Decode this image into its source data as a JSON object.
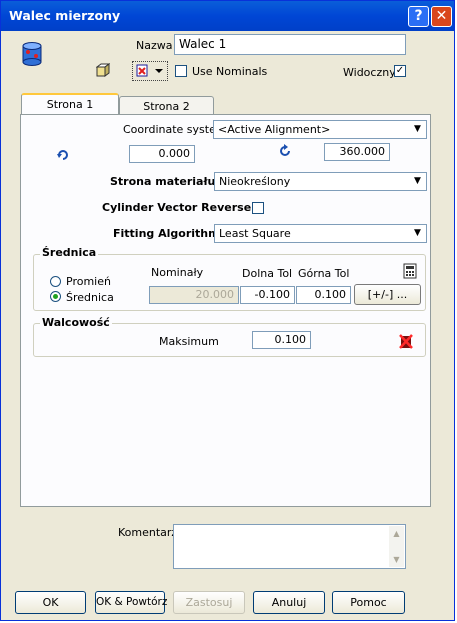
{
  "window": {
    "title": "Walec mierzony",
    "help_glyph": "?",
    "close_glyph": "✕"
  },
  "header": {
    "name_label": "Nazwa",
    "name_value": "Walec 1",
    "use_nominals_label": "Use Nominals",
    "use_nominals_checked": false,
    "visible_label": "Widoczny",
    "visible_checked": true,
    "check_glyph": "✓"
  },
  "tabs": [
    {
      "label": "Strona 1",
      "active": true
    },
    {
      "label": "Strona 2",
      "active": false
    }
  ],
  "page1": {
    "coord_system_label": "Coordinate system",
    "coord_system_value": "<Active Alignment>",
    "angle_start_value": "0.000",
    "angle_end_value": "360.000",
    "material_side_label": "Strona materiału",
    "material_side_value": "Nieokreślony",
    "cyl_vector_reverse_label": "Cylinder Vector Reverse",
    "fitting_algorithm_label": "Fitting Algorithm",
    "fitting_algorithm_value": "Least Square"
  },
  "diameter_group": {
    "title": "Średnica",
    "radius_option": "Promień",
    "diameter_option": "Średnica",
    "selected": "Średnica",
    "nominal_header": "Nominały",
    "lower_tol_header": "Dolna Tol",
    "upper_tol_header": "Górna Tol",
    "nominal_value": "20.000",
    "lower_tol_value": "-0.100",
    "upper_tol_value": "0.100",
    "plus_minus_button": "[+/-] ..."
  },
  "cylindricity_group": {
    "title": "Walcowość",
    "max_label": "Maksimum",
    "max_value": "0.100"
  },
  "comment": {
    "label": "Komentarz",
    "value": ""
  },
  "buttons": {
    "ok": "OK",
    "ok_repeat": "OK & Powtórz",
    "apply": "Zastosuj",
    "cancel": "Anuluj",
    "help": "Pomoc"
  },
  "colors": {
    "title_bar": "#0046d5",
    "dialog_bg": "#ece9d8",
    "close_button": "#d9461c"
  }
}
